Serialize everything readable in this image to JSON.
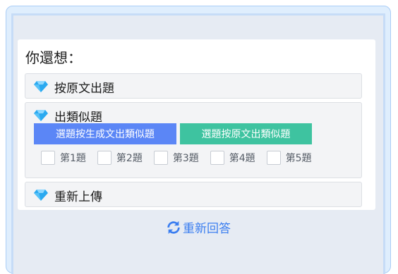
{
  "panel": {
    "heading": "你還想：",
    "options": [
      {
        "label": "按原文出題",
        "icon": "diamond-icon"
      },
      {
        "label": "出類似題",
        "icon": "diamond-icon"
      },
      {
        "label": "重新上傳",
        "icon": "diamond-icon"
      }
    ],
    "similar": {
      "generate_button": "選題按生成文出類似題",
      "original_button": "選題按原文出類似題",
      "questions": [
        "第1題",
        "第2題",
        "第3題",
        "第4題",
        "第5題"
      ]
    }
  },
  "reset": {
    "label": "重新回答",
    "icon": "refresh-icon"
  },
  "colors": {
    "accent_blue": "#5b86f6",
    "accent_green": "#3ec3a0",
    "link": "#3b7ef0"
  }
}
